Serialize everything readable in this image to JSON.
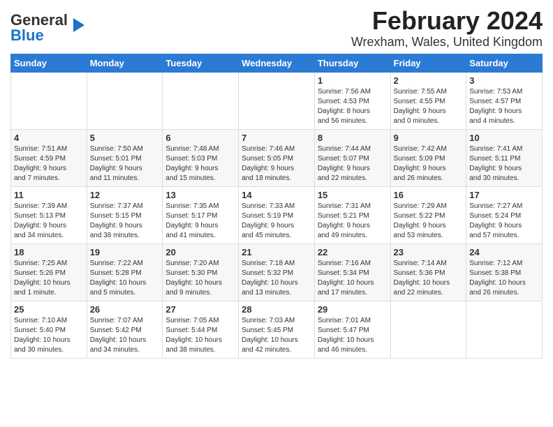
{
  "header": {
    "logo_line1": "General",
    "logo_line2": "Blue",
    "title": "February 2024",
    "subtitle": "Wrexham, Wales, United Kingdom"
  },
  "days_of_week": [
    "Sunday",
    "Monday",
    "Tuesday",
    "Wednesday",
    "Thursday",
    "Friday",
    "Saturday"
  ],
  "weeks": [
    [
      {
        "day": "",
        "info": ""
      },
      {
        "day": "",
        "info": ""
      },
      {
        "day": "",
        "info": ""
      },
      {
        "day": "",
        "info": ""
      },
      {
        "day": "1",
        "info": "Sunrise: 7:56 AM\nSunset: 4:53 PM\nDaylight: 8 hours\nand 56 minutes."
      },
      {
        "day": "2",
        "info": "Sunrise: 7:55 AM\nSunset: 4:55 PM\nDaylight: 9 hours\nand 0 minutes."
      },
      {
        "day": "3",
        "info": "Sunrise: 7:53 AM\nSunset: 4:57 PM\nDaylight: 9 hours\nand 4 minutes."
      }
    ],
    [
      {
        "day": "4",
        "info": "Sunrise: 7:51 AM\nSunset: 4:59 PM\nDaylight: 9 hours\nand 7 minutes."
      },
      {
        "day": "5",
        "info": "Sunrise: 7:50 AM\nSunset: 5:01 PM\nDaylight: 9 hours\nand 11 minutes."
      },
      {
        "day": "6",
        "info": "Sunrise: 7:48 AM\nSunset: 5:03 PM\nDaylight: 9 hours\nand 15 minutes."
      },
      {
        "day": "7",
        "info": "Sunrise: 7:46 AM\nSunset: 5:05 PM\nDaylight: 9 hours\nand 18 minutes."
      },
      {
        "day": "8",
        "info": "Sunrise: 7:44 AM\nSunset: 5:07 PM\nDaylight: 9 hours\nand 22 minutes."
      },
      {
        "day": "9",
        "info": "Sunrise: 7:42 AM\nSunset: 5:09 PM\nDaylight: 9 hours\nand 26 minutes."
      },
      {
        "day": "10",
        "info": "Sunrise: 7:41 AM\nSunset: 5:11 PM\nDaylight: 9 hours\nand 30 minutes."
      }
    ],
    [
      {
        "day": "11",
        "info": "Sunrise: 7:39 AM\nSunset: 5:13 PM\nDaylight: 9 hours\nand 34 minutes."
      },
      {
        "day": "12",
        "info": "Sunrise: 7:37 AM\nSunset: 5:15 PM\nDaylight: 9 hours\nand 38 minutes."
      },
      {
        "day": "13",
        "info": "Sunrise: 7:35 AM\nSunset: 5:17 PM\nDaylight: 9 hours\nand 41 minutes."
      },
      {
        "day": "14",
        "info": "Sunrise: 7:33 AM\nSunset: 5:19 PM\nDaylight: 9 hours\nand 45 minutes."
      },
      {
        "day": "15",
        "info": "Sunrise: 7:31 AM\nSunset: 5:21 PM\nDaylight: 9 hours\nand 49 minutes."
      },
      {
        "day": "16",
        "info": "Sunrise: 7:29 AM\nSunset: 5:22 PM\nDaylight: 9 hours\nand 53 minutes."
      },
      {
        "day": "17",
        "info": "Sunrise: 7:27 AM\nSunset: 5:24 PM\nDaylight: 9 hours\nand 57 minutes."
      }
    ],
    [
      {
        "day": "18",
        "info": "Sunrise: 7:25 AM\nSunset: 5:26 PM\nDaylight: 10 hours\nand 1 minute."
      },
      {
        "day": "19",
        "info": "Sunrise: 7:22 AM\nSunset: 5:28 PM\nDaylight: 10 hours\nand 5 minutes."
      },
      {
        "day": "20",
        "info": "Sunrise: 7:20 AM\nSunset: 5:30 PM\nDaylight: 10 hours\nand 9 minutes."
      },
      {
        "day": "21",
        "info": "Sunrise: 7:18 AM\nSunset: 5:32 PM\nDaylight: 10 hours\nand 13 minutes."
      },
      {
        "day": "22",
        "info": "Sunrise: 7:16 AM\nSunset: 5:34 PM\nDaylight: 10 hours\nand 17 minutes."
      },
      {
        "day": "23",
        "info": "Sunrise: 7:14 AM\nSunset: 5:36 PM\nDaylight: 10 hours\nand 22 minutes."
      },
      {
        "day": "24",
        "info": "Sunrise: 7:12 AM\nSunset: 5:38 PM\nDaylight: 10 hours\nand 26 minutes."
      }
    ],
    [
      {
        "day": "25",
        "info": "Sunrise: 7:10 AM\nSunset: 5:40 PM\nDaylight: 10 hours\nand 30 minutes."
      },
      {
        "day": "26",
        "info": "Sunrise: 7:07 AM\nSunset: 5:42 PM\nDaylight: 10 hours\nand 34 minutes."
      },
      {
        "day": "27",
        "info": "Sunrise: 7:05 AM\nSunset: 5:44 PM\nDaylight: 10 hours\nand 38 minutes."
      },
      {
        "day": "28",
        "info": "Sunrise: 7:03 AM\nSunset: 5:45 PM\nDaylight: 10 hours\nand 42 minutes."
      },
      {
        "day": "29",
        "info": "Sunrise: 7:01 AM\nSunset: 5:47 PM\nDaylight: 10 hours\nand 46 minutes."
      },
      {
        "day": "",
        "info": ""
      },
      {
        "day": "",
        "info": ""
      }
    ]
  ]
}
